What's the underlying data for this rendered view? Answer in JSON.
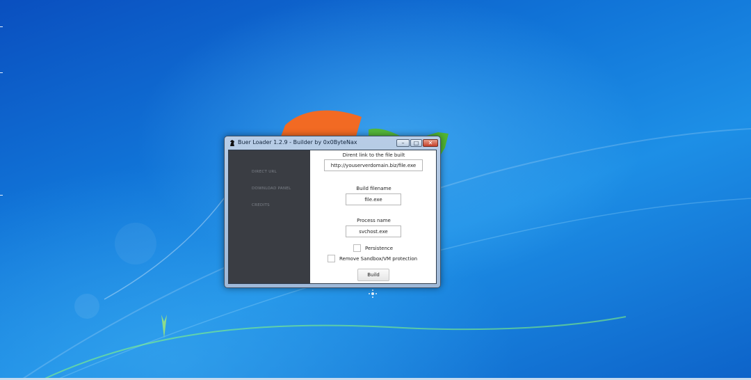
{
  "window": {
    "title": "Buer Loader 1.2.9 - Builder by 0x0ByteNax",
    "minimize_glyph": "–",
    "maximize_glyph": "□",
    "close_glyph": "✕"
  },
  "sidebar": {
    "items": [
      {
        "label": "DIRECT URL"
      },
      {
        "label": "DOWNLOAD PANEL"
      },
      {
        "label": "CREDITS"
      }
    ]
  },
  "form": {
    "direct_link_label": "Dirent link to the file built",
    "direct_link_value": "http://youserverdomain.biz/file.exe",
    "build_filename_label": "Build filename",
    "build_filename_value": "file.exe",
    "process_name_label": "Process name",
    "process_name_value": "svchost.exe",
    "persistence_label": "Persistence",
    "persistence_checked": false,
    "sandbox_label": "Remove Sandbox/VM protection",
    "sandbox_checked": false,
    "build_button_label": "Build"
  },
  "icons": {
    "app_icon": "chess-knight-icon",
    "wallpaper_logo": "windows-logo-icon"
  },
  "colors": {
    "desktop_blue": "#1175d8",
    "sidebar_bg": "#3a3d43",
    "close_red": "#c7412a"
  }
}
